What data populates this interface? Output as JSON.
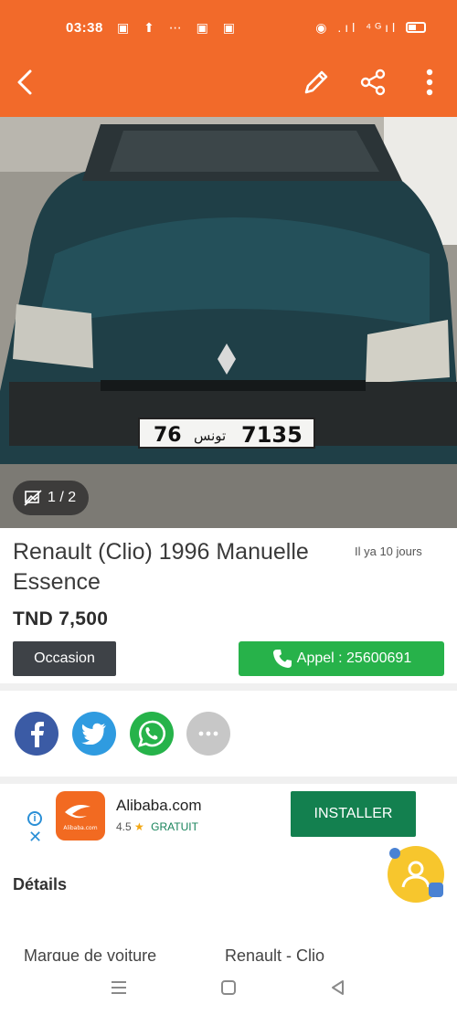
{
  "status_bar": {
    "time": "03:38",
    "notification_icons": "▣ ⬆ ⋯ ▣ ▣",
    "system_icons": "◉ .ıl ⁴ᴳıl"
  },
  "toolbar": {
    "background_color": "#f26a2a",
    "back_icon": "chevron-left-icon",
    "edit_icon": "pencil-icon",
    "share_icon": "share-icon",
    "more_icon": "more-vertical-icon"
  },
  "gallery": {
    "counter": "1 / 2"
  },
  "listing": {
    "title": "Renault (Clio) 1996 Manuelle Essence",
    "posted": "Il ya 10 jours",
    "price": "TND 7,500",
    "condition": "Occasion",
    "call_label": "Appel : 25600691",
    "plate_number": "7135",
    "plate_region": "76 تونس"
  },
  "share": {
    "facebook_icon": "facebook-icon",
    "twitter_icon": "twitter-icon",
    "whatsapp_icon": "whatsapp-icon",
    "more_icon": "more-horizontal-icon",
    "colors": {
      "facebook": "#3b5ba5",
      "twitter": "#2f9be0",
      "whatsapp": "#26b34a",
      "more": "#c7c7c7"
    }
  },
  "ad": {
    "app_name": "Alibaba.com",
    "rating": "4.5",
    "price_label": "GRATUIT",
    "install_label": "INSTALLER",
    "logo_text": "Alibaba.com",
    "install_color": "#13804f"
  },
  "details": {
    "title": "Détails",
    "rows": [
      {
        "label": "Marque de voiture",
        "value": "Renault - Clio"
      }
    ]
  }
}
